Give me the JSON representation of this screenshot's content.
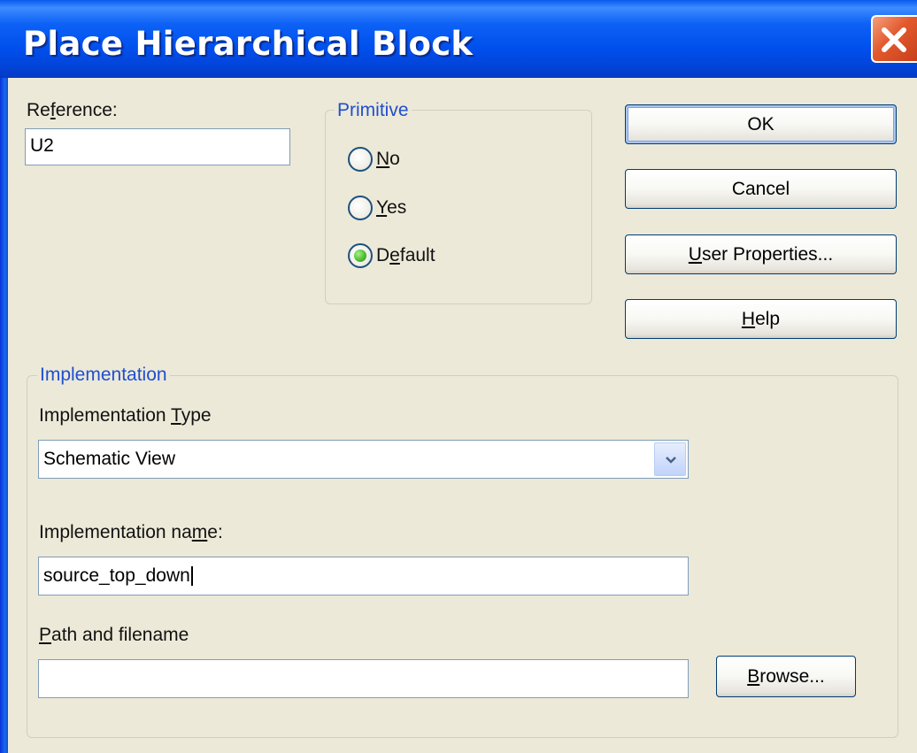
{
  "window": {
    "title": "Place Hierarchical Block"
  },
  "reference": {
    "label_pre": "Re",
    "label_u": "f",
    "label_post": "erence:",
    "value": "U2"
  },
  "primitive": {
    "legend": "Primitive",
    "options": [
      {
        "u": "N",
        "rest": "o",
        "pre": "",
        "selected": false
      },
      {
        "u": "Y",
        "rest": "es",
        "pre": "",
        "selected": false
      },
      {
        "pre": "D",
        "u": "e",
        "rest": "fault",
        "selected": true
      }
    ]
  },
  "buttons": {
    "ok": "OK",
    "cancel": "Cancel",
    "user_properties": {
      "u": "U",
      "rest": "ser Properties..."
    },
    "help": {
      "u": "H",
      "rest": "elp"
    },
    "browse": {
      "u": "B",
      "rest": "rowse..."
    }
  },
  "implementation": {
    "legend": "Implementation",
    "type_label": {
      "pre": "Implementation ",
      "u": "T",
      "post": "ype"
    },
    "type_value": "Schematic View",
    "name_label": {
      "pre": "Implementation na",
      "u": "m",
      "post": "e:"
    },
    "name_value": "source_top_down",
    "path_label": {
      "pre": "",
      "u": "P",
      "post": "ath and filename"
    },
    "path_value": ""
  }
}
